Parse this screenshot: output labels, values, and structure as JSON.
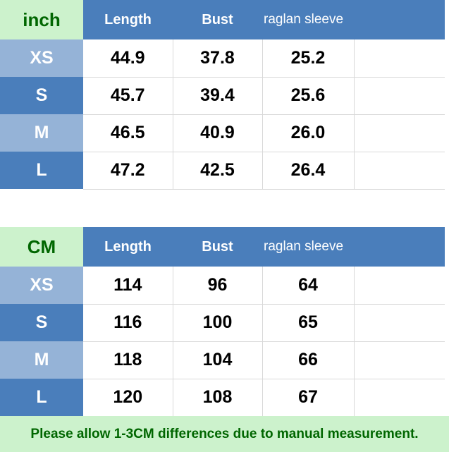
{
  "colors": {
    "header_blue": "#4a7ebb",
    "row_blue_light": "#95b3d7",
    "row_blue_dark": "#4a7ebb",
    "unit_green_bg": "#ccf2cc",
    "green_text": "#006600",
    "value_text": "#000000",
    "grid_line": "#d9d9d9"
  },
  "tables": [
    {
      "unit_label": "inch",
      "columns": [
        "Length",
        "Bust",
        "raglan sleeve",
        ""
      ],
      "rows": [
        {
          "size": "XS",
          "length": "44.9",
          "bust": "37.8",
          "raglan": "25.2",
          "blank": ""
        },
        {
          "size": "S",
          "length": "45.7",
          "bust": "39.4",
          "raglan": "25.6",
          "blank": ""
        },
        {
          "size": "M",
          "length": "46.5",
          "bust": "40.9",
          "raglan": "26.0",
          "blank": ""
        },
        {
          "size": "L",
          "length": "47.2",
          "bust": "42.5",
          "raglan": "26.4",
          "blank": ""
        }
      ]
    },
    {
      "unit_label": "CM",
      "columns": [
        "Length",
        "Bust",
        "raglan sleeve",
        ""
      ],
      "rows": [
        {
          "size": "XS",
          "length": "114",
          "bust": "96",
          "raglan": "64",
          "blank": ""
        },
        {
          "size": "S",
          "length": "116",
          "bust": "100",
          "raglan": "65",
          "blank": ""
        },
        {
          "size": "M",
          "length": "118",
          "bust": "104",
          "raglan": "66",
          "blank": ""
        },
        {
          "size": "L",
          "length": "120",
          "bust": "108",
          "raglan": "67",
          "blank": ""
        }
      ]
    }
  ],
  "footer": {
    "note": "Please allow 1-3CM differences due to manual measurement."
  }
}
